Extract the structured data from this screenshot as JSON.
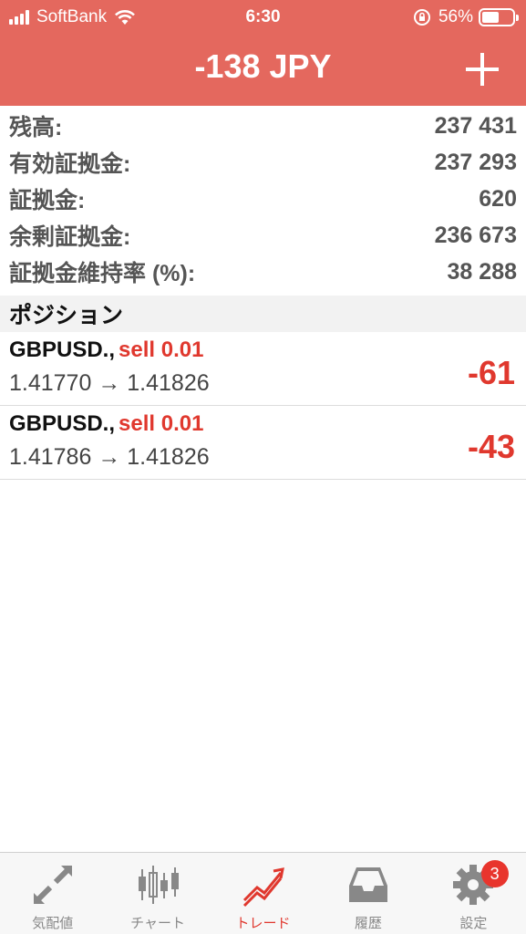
{
  "status_bar": {
    "carrier": "SoftBank",
    "time": "6:30",
    "battery": "56%"
  },
  "header": {
    "title": "-138 JPY"
  },
  "summary": [
    {
      "label": "残高:",
      "value": "237 431"
    },
    {
      "label": "有効証拠金:",
      "value": "237 293"
    },
    {
      "label": "証拠金:",
      "value": "620"
    },
    {
      "label": "余剰証拠金:",
      "value": "236 673"
    },
    {
      "label": "証拠金維持率 (%):",
      "value": "38 288"
    }
  ],
  "section_title": "ポジション",
  "positions": [
    {
      "symbol": "GBPUSD.,",
      "side": "sell 0.01",
      "prices": "1.41770 → 1.41826",
      "profit": "-61"
    },
    {
      "symbol": "GBPUSD.,",
      "side": "sell 0.01",
      "prices": "1.41786 → 1.41826",
      "profit": "-43"
    }
  ],
  "tabs": [
    {
      "label": "気配値",
      "icon": "quotes-icon"
    },
    {
      "label": "チャート",
      "icon": "chart-icon"
    },
    {
      "label": "トレード",
      "icon": "trade-icon",
      "active": true
    },
    {
      "label": "履歴",
      "icon": "history-icon"
    },
    {
      "label": "設定",
      "icon": "settings-icon",
      "badge": "3"
    }
  ],
  "colors": {
    "header_bg": "#e4685e",
    "loss": "#e0382e",
    "badge": "#e8352d"
  }
}
